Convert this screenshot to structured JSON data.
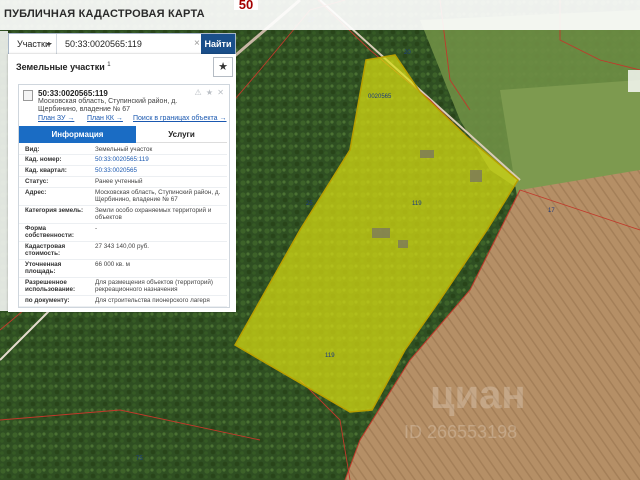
{
  "app": {
    "title": "ПУБЛИЧНАЯ КАДАСТРОВАЯ КАРТА",
    "zoom_tab": "50"
  },
  "search": {
    "type_label": "Участки",
    "query": "50:33:0020565:119",
    "clear_symbol": "×",
    "button_label": "Найти"
  },
  "panel": {
    "header": "Земельные участки",
    "count": "1",
    "star_symbol": "★"
  },
  "card": {
    "number": "50:33:0020565:119",
    "controls": "⚠ ★ ✕",
    "address": "Московская область, Ступинский район, д. Щербинино, владение № 67",
    "links": [
      "План ЗУ →",
      "План КК →",
      "Поиск в границах объекта →"
    ],
    "tabs": [
      "Информация",
      "Услуги"
    ],
    "rows": [
      {
        "k": "Вид:",
        "v": "Земельный участок",
        "link": false
      },
      {
        "k": "Кад. номер:",
        "v": "50:33:0020565:119",
        "link": true
      },
      {
        "k": "Кад. квартал:",
        "v": "50:33:0020565",
        "link": true
      },
      {
        "k": "Статус:",
        "v": "Ранее учтенный",
        "link": false
      },
      {
        "k": "Адрес:",
        "v": "Московская область, Ступинский район, д. Щербинино, владение № 67",
        "link": false
      },
      {
        "k": "Категория земель:",
        "v": "Земли особо охраняемых территорий и объектов",
        "link": false
      },
      {
        "k": "Форма собственности:",
        "v": "-",
        "link": false
      },
      {
        "k": "Кадастровая стоимость:",
        "v": "27 343 140,00 руб.",
        "link": false
      },
      {
        "k": "Уточненная площадь:",
        "v": "66 000 кв. м",
        "link": false
      },
      {
        "k": "Разрешенное использование:",
        "v": "Для размещения объектов (территорий) рекреационного назначения",
        "link": false
      },
      {
        "k": "по документу:",
        "v": "Для строительства пионерского лагеря",
        "link": false
      }
    ]
  },
  "map": {
    "labels": [
      "27",
      "20",
      "0020565",
      "119",
      "119",
      "25",
      "17",
      "75"
    ],
    "watermark_1": "циан",
    "watermark_2": "ID 266553198",
    "colors": {
      "parcel_fill": "#d8dc12",
      "parcel_stroke": "#b7a000",
      "boundary": "#c0392b",
      "forest": "#2f4f22",
      "field": "#b08a62"
    }
  }
}
